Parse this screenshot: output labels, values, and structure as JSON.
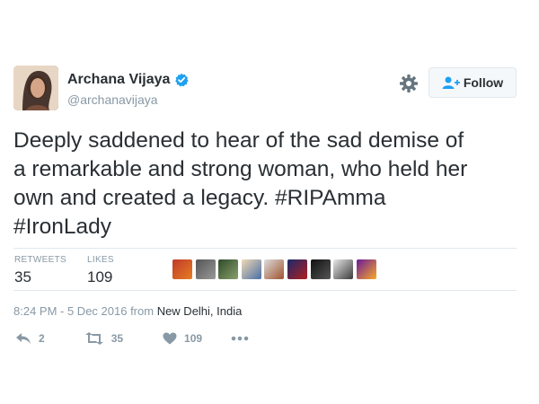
{
  "user": {
    "name": "Archana Vijaya",
    "handle": "@archanavijaya",
    "verified": true
  },
  "follow_button": {
    "label": "Follow"
  },
  "tweet": {
    "text_line1": "Deeply saddened to hear of the sad demise of",
    "text_line2": "a remarkable and strong woman, who held her",
    "text_line3_prefix": "own and created a legacy. ",
    "hashtag1": "#RIPAmma",
    "hashtag2": "#IronLady"
  },
  "stats": {
    "retweets_label": "RETWEETS",
    "retweets_value": "35",
    "likes_label": "LIKES",
    "likes_value": "109"
  },
  "likers_count_shown": 9,
  "meta": {
    "time": "8:24 PM - 5 Dec 2016 from ",
    "location": "New Delhi, India"
  },
  "actions": {
    "reply_count": "2",
    "retweet_count": "35",
    "like_count": "109"
  },
  "colors": {
    "text": "#292f33",
    "muted": "#8899a6",
    "verified": "#1da1f2",
    "border": "#e1e8ed"
  }
}
